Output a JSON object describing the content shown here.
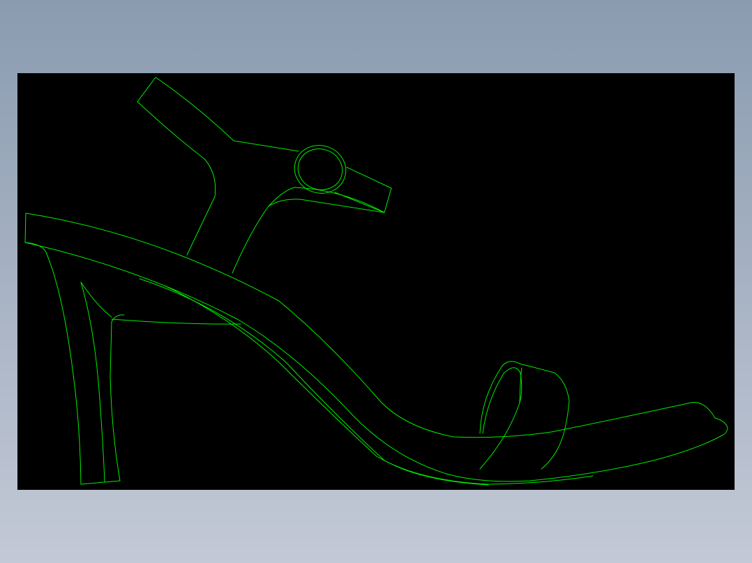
{
  "viewport": {
    "background_color": "#000000",
    "line_color": "#00ee00"
  },
  "page": {
    "background_top_color": "#8a9bb0",
    "background_bottom_color": "#c3c9d6"
  },
  "drawing": {
    "subject": "sandal-side-view",
    "parts": [
      "ankle-strap",
      "buckle",
      "heel-counter",
      "insole",
      "outsole",
      "heel",
      "toe-strap"
    ]
  }
}
